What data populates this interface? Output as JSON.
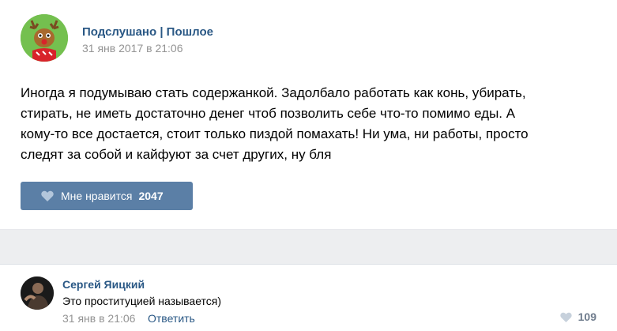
{
  "post": {
    "author": "Подслушано | Пошлое",
    "date": "31 янв 2017 в 21:06",
    "avatar_icon": "reindeer-avatar",
    "text_lines": [
      "Иногда я подумываю стать содержанкой. Задолбало работать как конь, убирать,",
      "стирать, не иметь достаточно денег чтоб позволить себе что-то помимо еды. А",
      "кому-то все достается, стоит только пиздой помахать! Ни ума, ни работы, просто",
      "следят за собой и кайфуют за счет других, ну бля"
    ],
    "like": {
      "label": "Мне нравится",
      "count": "2047",
      "icon": "heart-icon"
    }
  },
  "comment": {
    "author": "Сергей Яицкий",
    "text": "Это проституцией называется)",
    "date": "31 янв в 21:06",
    "reply_label": "Ответить",
    "likes": "109",
    "like_icon": "heart-icon"
  },
  "colors": {
    "link": "#2a5885",
    "like_button": "#5b7fa6",
    "muted": "#939393",
    "separator_band": "#edeef0"
  }
}
